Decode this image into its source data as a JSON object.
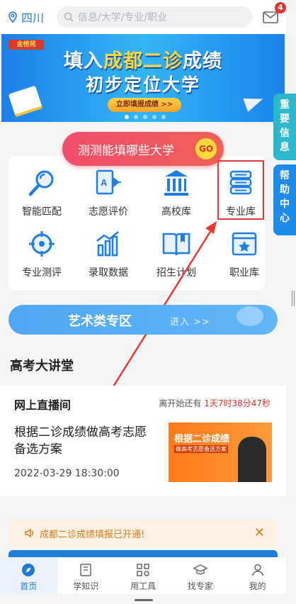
{
  "header": {
    "location": "四川",
    "search_placeholder": "信息/大学/专业/职业",
    "mail_badge": "4"
  },
  "banner": {
    "logo": "金榜苑",
    "line1_prefix": "填入",
    "line1_highlight": "成都二诊",
    "line1_suffix": "成绩",
    "line2": "初步定位大学",
    "cta": "立即填报成绩 >>",
    "dots": 5,
    "active_dot": 0
  },
  "side_tabs": {
    "important": "重要信息",
    "help": "帮助中心"
  },
  "promo": {
    "label": "测测能填哪些大学",
    "go": "GO"
  },
  "tools": [
    {
      "label": "智能匹配",
      "icon": "magnifier-icon"
    },
    {
      "label": "志愿评价",
      "icon": "assessment-icon"
    },
    {
      "label": "高校库",
      "icon": "university-icon"
    },
    {
      "label": "专业库",
      "icon": "books-icon"
    },
    {
      "label": "专业测评",
      "icon": "target-icon"
    },
    {
      "label": "录取数据",
      "icon": "bar-chart-icon"
    },
    {
      "label": "招生计划",
      "icon": "open-book-icon"
    },
    {
      "label": "职业库",
      "icon": "career-icon"
    }
  ],
  "art_zone": {
    "title": "艺术类专区",
    "enter": "进入 >>"
  },
  "section_title": "高考大讲堂",
  "live": {
    "heading": "网上直播间",
    "countdown_prefix": "离开始还有",
    "countdown": "1天7时38分47秒",
    "title": "根据二诊成绩做高考志愿备选方案",
    "datetime": "2022-03-29 18:30:00",
    "thumb_title": "根据二诊成绩",
    "thumb_sub": "做高考志愿备选方案"
  },
  "notice": {
    "text": "成都二诊成绩填报已开通!",
    "close": "✕"
  },
  "nav": [
    {
      "label": "首页",
      "icon": "compass-icon",
      "active": true
    },
    {
      "label": "学知识",
      "icon": "book-icon",
      "active": false
    },
    {
      "label": "用工具",
      "icon": "grid-tool-icon",
      "active": false
    },
    {
      "label": "找专家",
      "icon": "graduation-cap-icon",
      "active": false
    },
    {
      "label": "我的",
      "icon": "user-icon",
      "active": false
    }
  ],
  "colors": {
    "primary": "#2a7be4",
    "annotation_red": "#e53935"
  }
}
